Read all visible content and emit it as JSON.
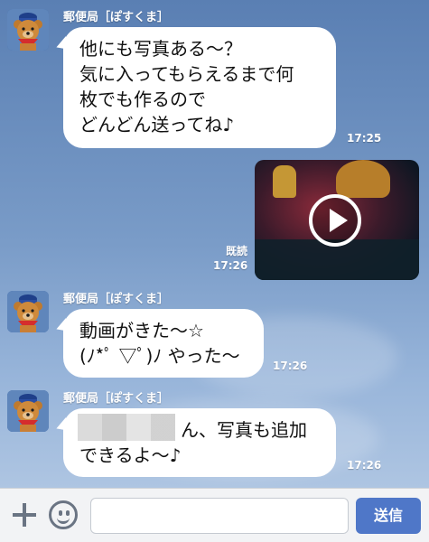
{
  "messages": [
    {
      "sender": "郵便局［ぽすくま］",
      "lines": [
        "他にも写真ある〜？",
        "気に入ってもらえるまで何",
        "枚でも作るので",
        "どんどん送ってね♪"
      ],
      "time": "17:25"
    },
    {
      "read_label": "既読",
      "time": "17:26",
      "video": true
    },
    {
      "sender": "郵便局［ぽすくま］",
      "lines": [
        "動画がきた〜☆",
        "(ﾉ*ﾟ ▽ﾟ)ﾉ やった〜"
      ],
      "time": "17:26"
    },
    {
      "sender": "郵便局［ぽすくま］",
      "lines": [
        "ん、写真も追加",
        "できるよ〜♪"
      ],
      "time": "17:26"
    }
  ],
  "input": {
    "placeholder": "",
    "send_label": "送信"
  },
  "icons": {
    "plus": "plus-icon",
    "emoji": "smiley-icon",
    "play": "play-icon"
  },
  "colors": {
    "send_button": "#4f77c8",
    "bubble": "#ffffff"
  }
}
